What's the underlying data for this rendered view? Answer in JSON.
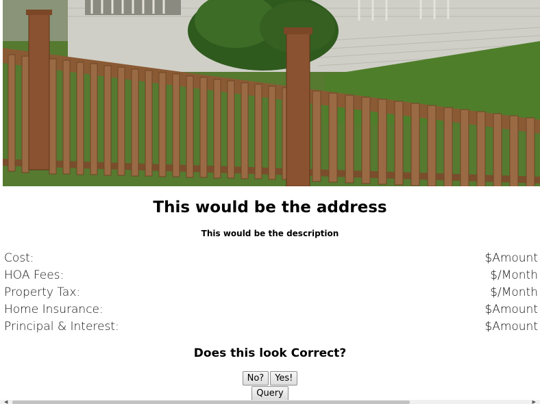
{
  "hero": {
    "alt": "House with wooden fence"
  },
  "listing": {
    "address": "This would be the address",
    "description": "This would be the description"
  },
  "costs": [
    {
      "label": "Cost:",
      "value": "$Amount"
    },
    {
      "label": "HOA Fees:",
      "value": "$/Month"
    },
    {
      "label": "Property Tax:",
      "value": "$/Month"
    },
    {
      "label": "Home Insurance:",
      "value": "$Amount"
    },
    {
      "label": "Principal & Interest:",
      "value": "$Amount"
    }
  ],
  "confirm": {
    "question": "Does this look Correct?",
    "no_label": "No?",
    "yes_label": "Yes!",
    "query_label": "Query"
  }
}
